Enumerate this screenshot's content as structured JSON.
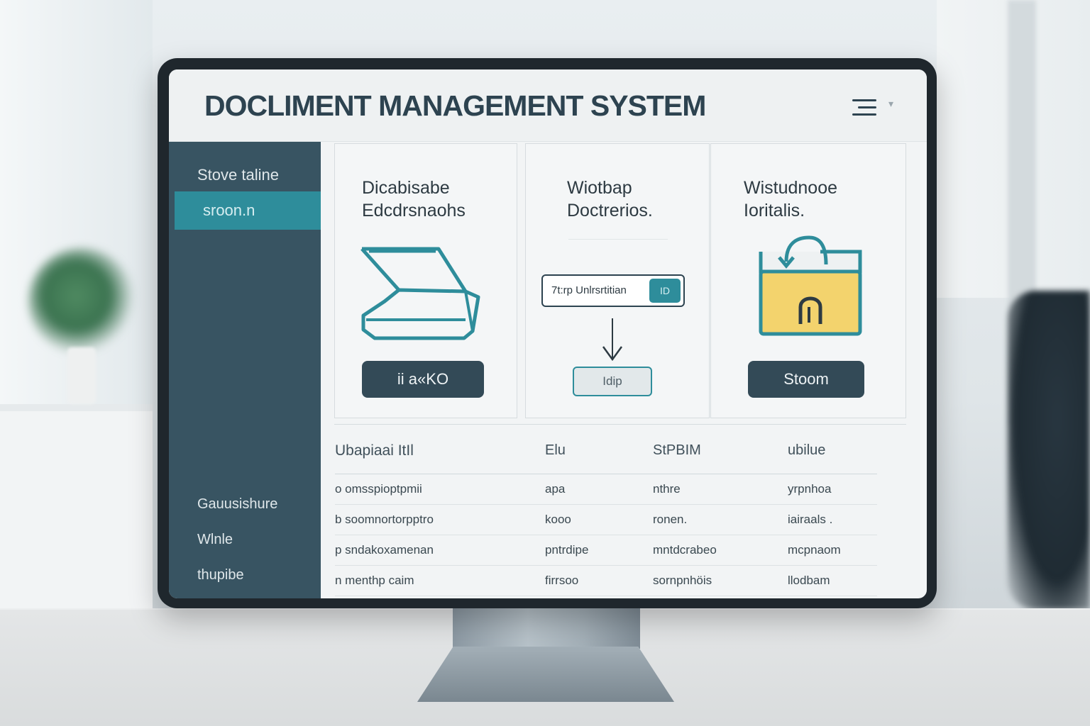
{
  "header": {
    "title": "DOCLIMENT MANAGEMENT SYSTEM",
    "menu_icon": "hamburger-menu-icon"
  },
  "sidebar": {
    "top_item": "Stove taline",
    "active_item": "sroon.n",
    "bottom_items": [
      "Gauusishure",
      "Wlnle",
      "thupibe"
    ]
  },
  "cards": [
    {
      "title_line1": "Dicabisabe",
      "title_line2": "Edcdrsnaohs",
      "icon": "scanner-icon",
      "button_label": "ii a«KO"
    },
    {
      "title_line1": "Wiotbap",
      "title_line2": "Doctrerios.",
      "icon": "workflow-icon",
      "field_text": "7t:rp Unlrsrtitian",
      "field_tag": "ID",
      "box_label": "Idip"
    },
    {
      "title_line1": "Wistudnooe",
      "title_line2": "Ioritalis.",
      "icon": "lock-folder-icon",
      "button_label": "Stoom"
    }
  ],
  "table": {
    "headers": [
      "Ubapiaai ItIl",
      "Elu",
      "StPBIM",
      "ubilue"
    ],
    "rows": [
      [
        "o omsspioptpmii",
        "apa",
        "nthre",
        "yrpnhoa"
      ],
      [
        "b soomnortorpptro",
        "kooo",
        "ronen.",
        "iairaals ."
      ],
      [
        "p sndakoxamenan",
        "pntrdipe",
        "mntdcrabeo",
        "mcpnaom"
      ],
      [
        "n menthp caim",
        "firrsoo",
        "sornpnhöis",
        "llodbam"
      ]
    ]
  },
  "colors": {
    "sidebar": "#385462",
    "accent": "#2e8d9b",
    "button": "#334a57",
    "title": "#2d4350",
    "folder": "#f3d36d"
  }
}
